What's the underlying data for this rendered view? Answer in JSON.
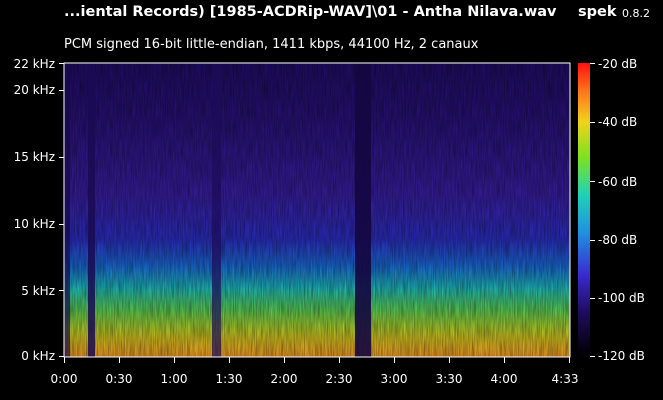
{
  "header": {
    "file_title": "...iental Records) [1985-ACDRip-WAV]\\01 - Antha Nilava.wav",
    "app_name": "spek",
    "app_version": "0.8.2",
    "stream_info": "PCM signed 16-bit little-endian, 1411 kbps, 44100 Hz, 2 canaux"
  },
  "frequency_axis": {
    "ticks": [
      "22 kHz",
      "20 kHz",
      "15 kHz",
      "10 kHz",
      "5 kHz",
      "0 kHz"
    ]
  },
  "time_axis": {
    "ticks": [
      "0:00",
      "0:30",
      "1:00",
      "1:30",
      "2:00",
      "2:30",
      "3:00",
      "3:30",
      "4:00",
      "4:33"
    ]
  },
  "level_scale": {
    "ticks": [
      "-20 dB",
      "-40 dB",
      "-60 dB",
      "-80 dB",
      "-100 dB",
      "-120 dB"
    ]
  },
  "colors": {
    "background": "#000000",
    "text": "#ffffff"
  }
}
